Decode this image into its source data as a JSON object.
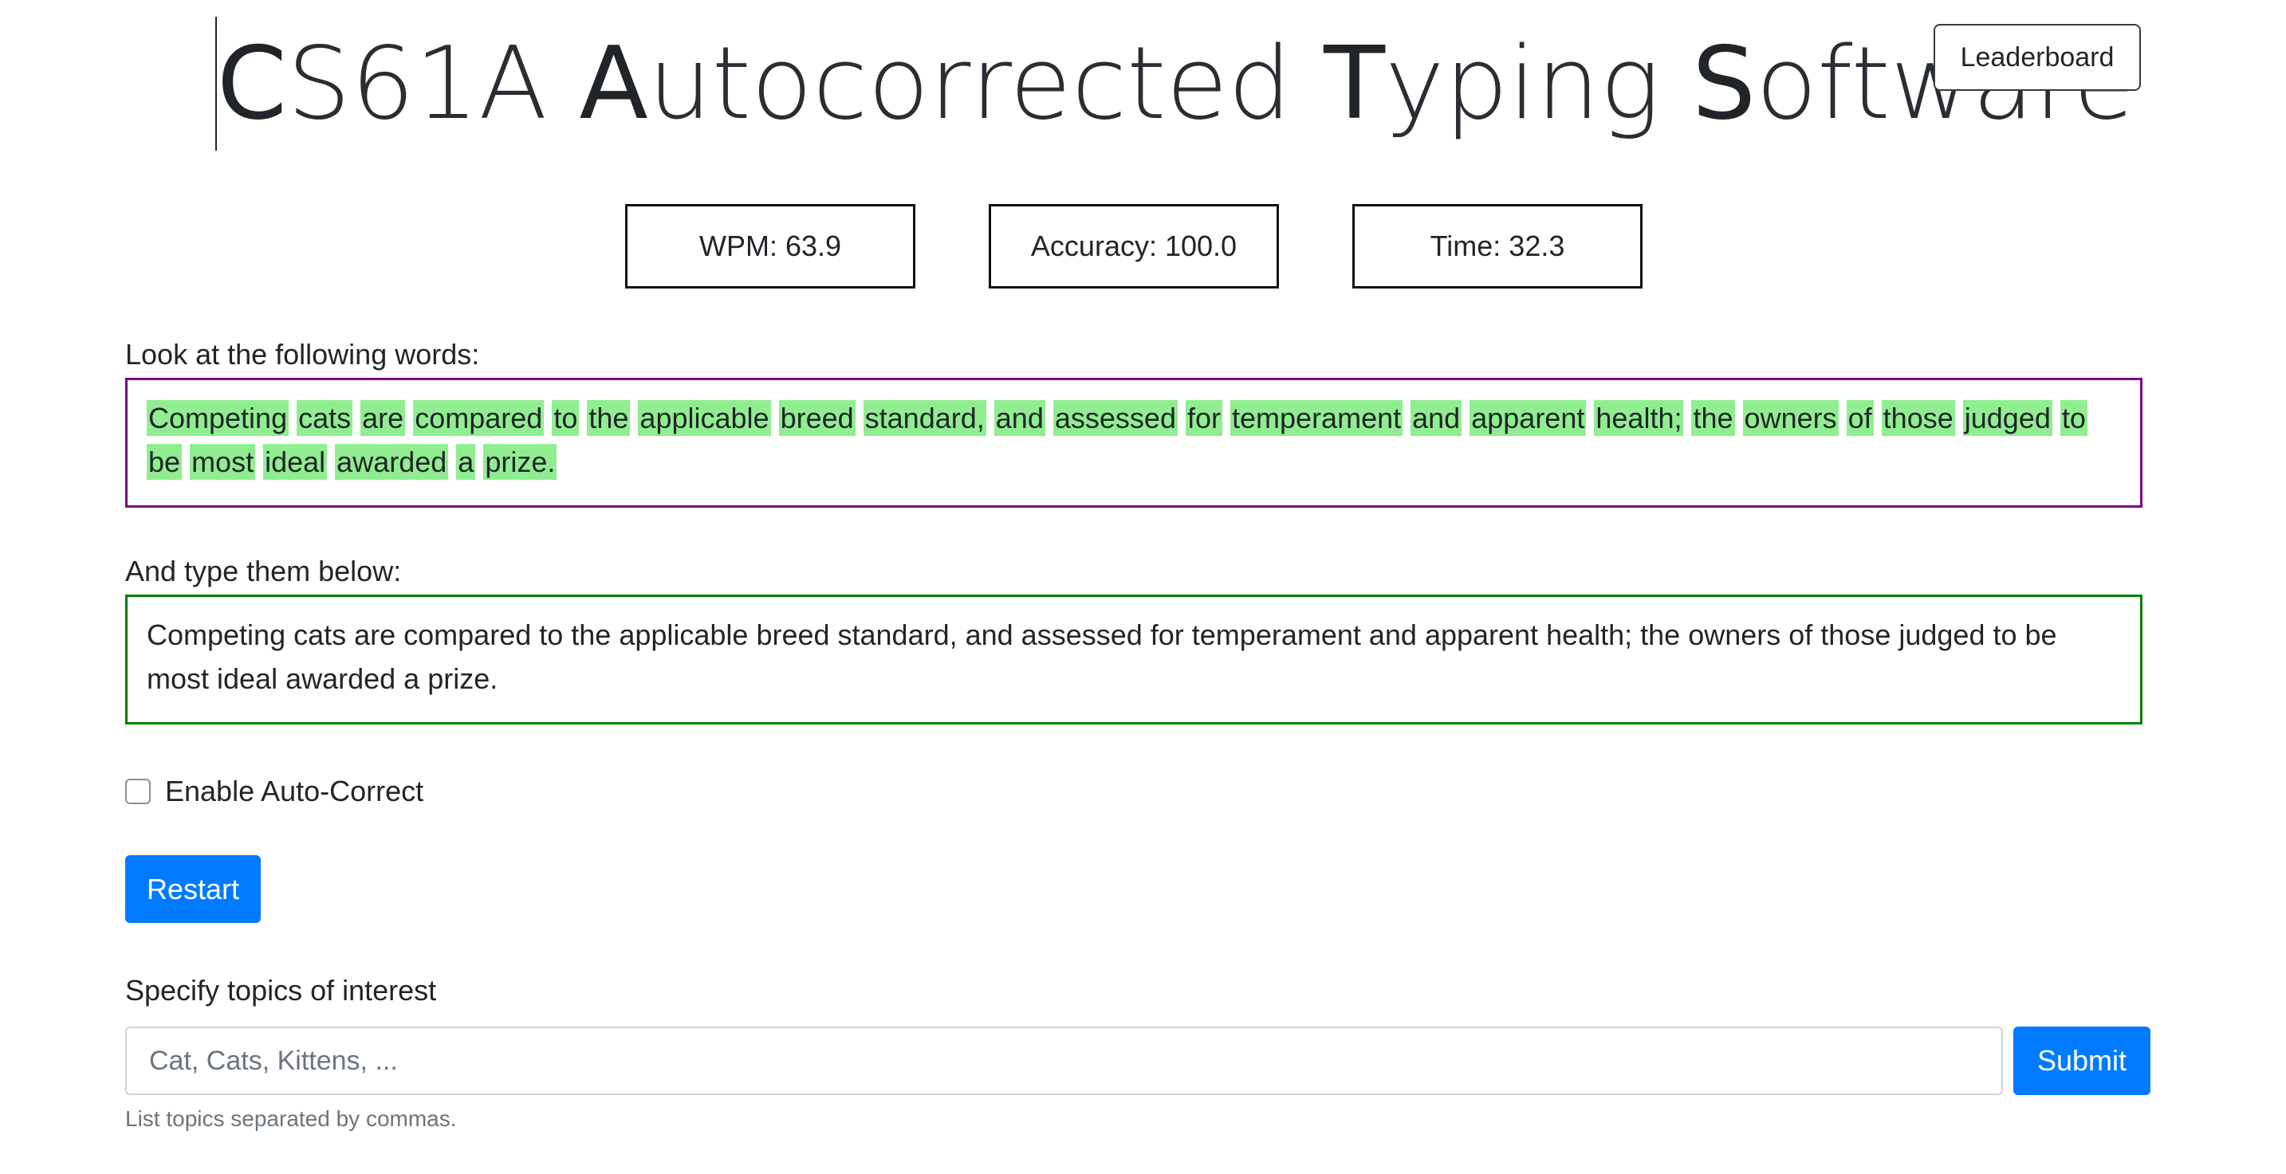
{
  "header": {
    "title_segments": [
      {
        "cap": "C",
        "rest": "S61A "
      },
      {
        "cap": "A",
        "rest": "utocorrected "
      },
      {
        "cap": "T",
        "rest": "yping "
      },
      {
        "cap": "S",
        "rest": "oftware"
      }
    ],
    "leaderboard_label": "Leaderboard"
  },
  "stats": {
    "wpm": "WPM: 63.9",
    "accuracy": "Accuracy: 100.0",
    "time": "Time: 32.3"
  },
  "prompt": {
    "label": "Look at the following words:",
    "words": [
      "Competing",
      "cats",
      "are",
      "compared",
      "to",
      "the",
      "applicable",
      "breed",
      "standard,",
      "and",
      "assessed",
      "for",
      "temperament",
      "and",
      "apparent",
      "health;",
      "the",
      "owners",
      "of",
      "those",
      "judged",
      "to",
      "be",
      "most",
      "ideal",
      "awarded",
      "a",
      "prize."
    ],
    "highlight_color": "#90ee90",
    "border_color": "#800080"
  },
  "typed": {
    "label": "And type them below:",
    "value": "Competing cats are compared to the applicable breed standard, and assessed for temperament and apparent health; the owners of those judged to be most ideal awarded a prize.",
    "border_color": "#008000"
  },
  "autocorrect": {
    "label": "Enable Auto-Correct",
    "checked": false
  },
  "restart_label": "Restart",
  "topics": {
    "label": "Specify topics of interest",
    "placeholder": "Cat, Cats, Kittens, ...",
    "submit_label": "Submit",
    "help": "List topics separated by commas."
  },
  "colors": {
    "primary": "#007bff"
  }
}
